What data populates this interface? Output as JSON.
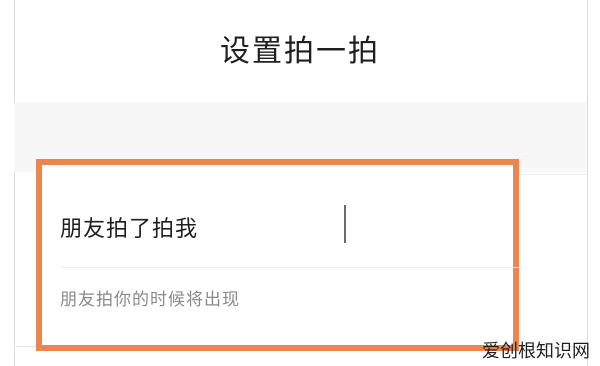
{
  "header": {
    "title": "设置拍一拍"
  },
  "pat_setting": {
    "value": "朋友拍了拍我",
    "hint": "朋友拍你的时候将出现"
  },
  "watermark": {
    "text": "爱创根知识网"
  },
  "colors": {
    "highlight": "#eb8650"
  }
}
